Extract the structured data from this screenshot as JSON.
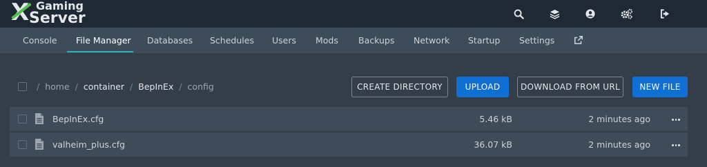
{
  "brand": {
    "logo_line1": "Gaming",
    "logo_line2": "Server",
    "logo_letter": "X",
    "accent_color": "#4fc14f"
  },
  "header": {
    "icons": [
      "search-icon",
      "layers-icon",
      "user-circle-icon",
      "cogs-icon",
      "sign-out-icon"
    ]
  },
  "nav": {
    "items": [
      {
        "label": "Console"
      },
      {
        "label": "File Manager"
      },
      {
        "label": "Databases"
      },
      {
        "label": "Schedules"
      },
      {
        "label": "Users"
      },
      {
        "label": "Mods"
      },
      {
        "label": "Backups"
      },
      {
        "label": "Network"
      },
      {
        "label": "Startup"
      },
      {
        "label": "Settings"
      }
    ],
    "active_index": 1,
    "external_icon": "external-link-icon",
    "underline_color": "#2bb3c0"
  },
  "breadcrumb": {
    "root": "/",
    "segments": [
      "home",
      "container",
      "BepInEx",
      "config"
    ],
    "separator": "/"
  },
  "actions": {
    "create_directory": "CREATE DIRECTORY",
    "upload": "UPLOAD",
    "download_from_url": "DOWNLOAD FROM URL",
    "new_file": "NEW FILE",
    "primary_color": "#0f6fd4"
  },
  "files": [
    {
      "name": "BepInEx.cfg",
      "size": "5.46 kB",
      "modified": "2 minutes ago",
      "icon": "file-icon"
    },
    {
      "name": "valheim_plus.cfg",
      "size": "36.07 kB",
      "modified": "2 minutes ago",
      "icon": "file-icon"
    }
  ]
}
